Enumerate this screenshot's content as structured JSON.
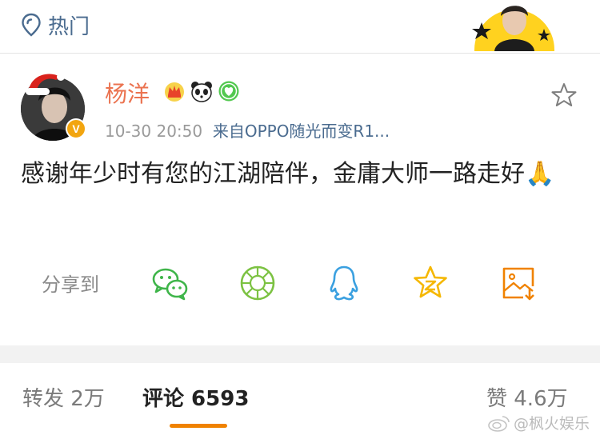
{
  "header": {
    "hot_label": "热门"
  },
  "post": {
    "username": "杨洋",
    "time": "10-30 20:50",
    "source": "来自OPPO随光而变R1...",
    "content": "感谢年少时有您的江湖陪伴，金庸大师一路走好🙏",
    "verified_badge": "V"
  },
  "share": {
    "label": "分享到",
    "targets": [
      "wechat-icon",
      "moments-icon",
      "qq-icon",
      "qzone-icon",
      "save-image-icon"
    ]
  },
  "stats": {
    "repost": "转发 2万",
    "comments": "评论 6593",
    "likes": "赞 4.6万"
  },
  "watermark": "@枫火娱乐",
  "colors": {
    "username": "#eb7350",
    "link": "#4a6b8f",
    "wechat": "#3fb54a",
    "moments": "#7cc242",
    "qq": "#3aa0e0",
    "qzone": "#f5b700",
    "save": "#f08200",
    "tab_underline": "#f08200"
  }
}
